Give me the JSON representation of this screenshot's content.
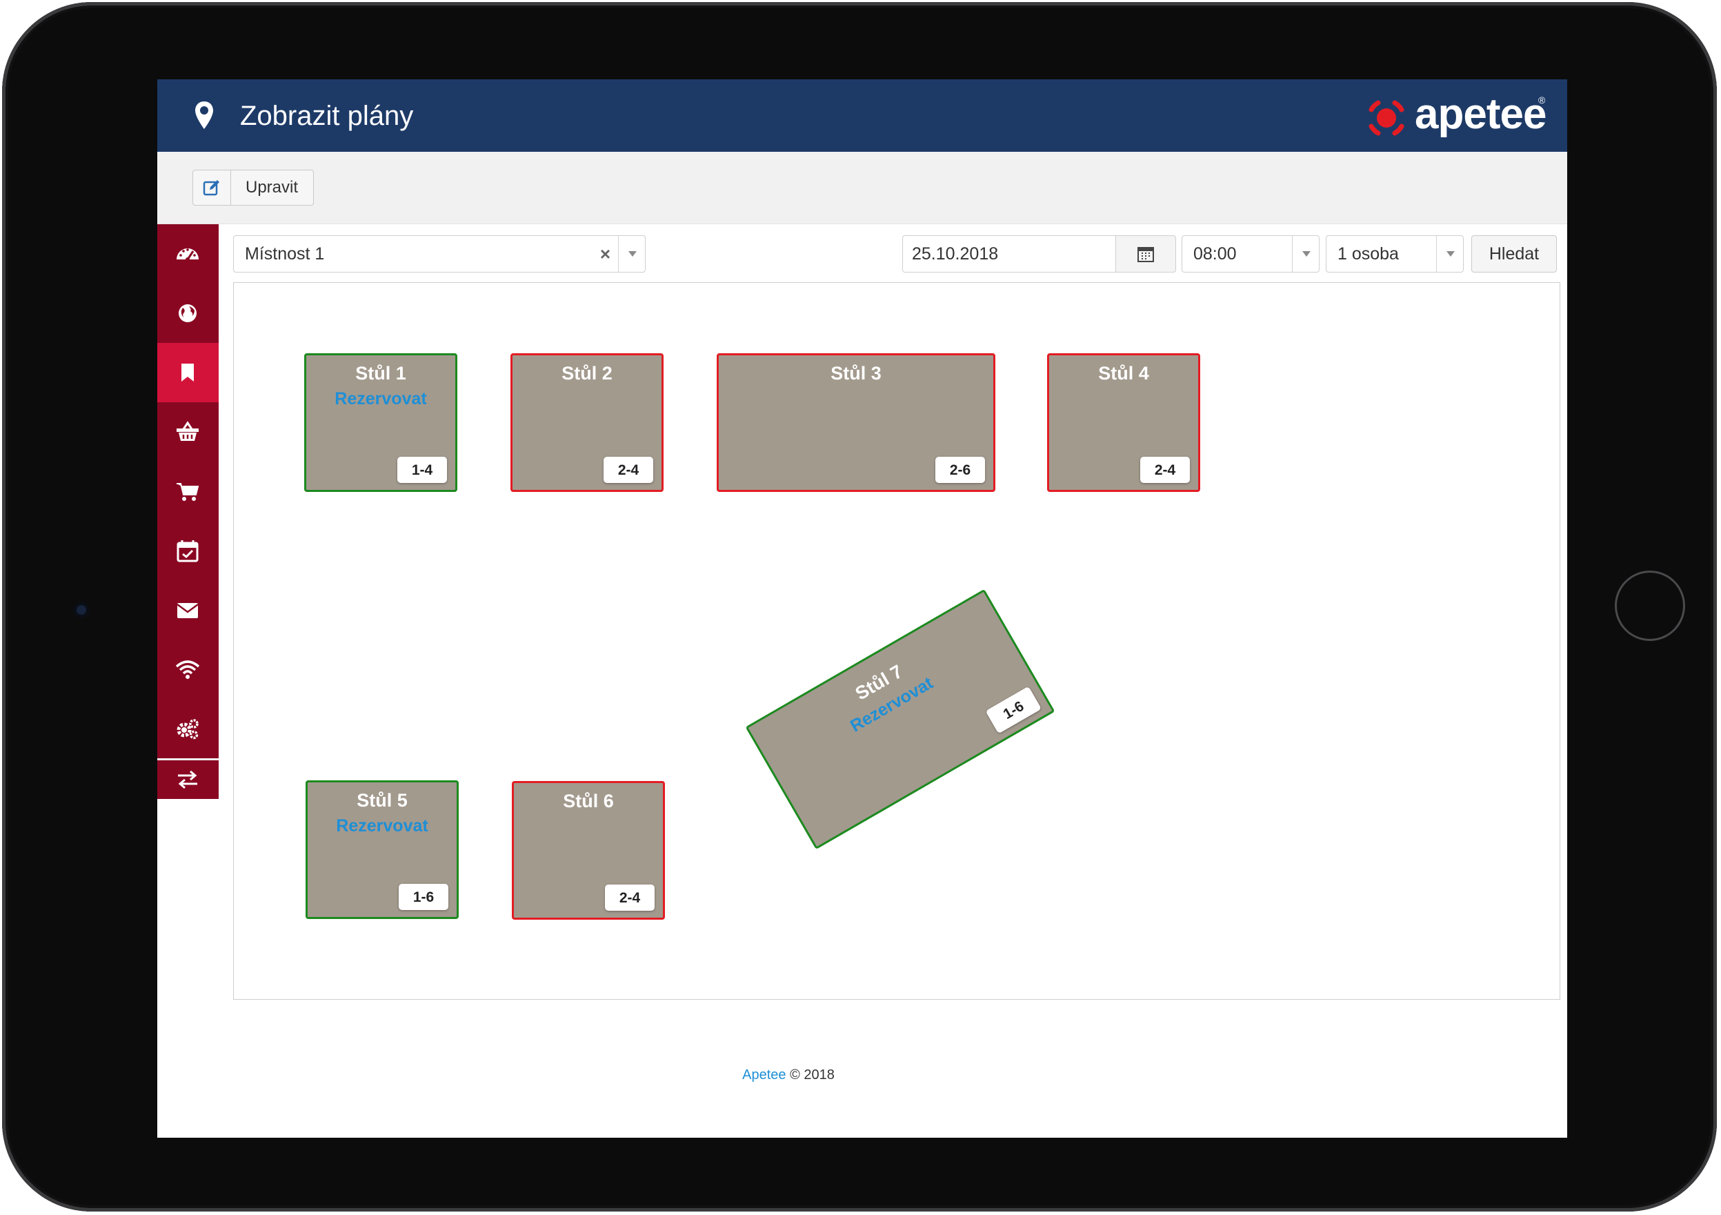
{
  "header": {
    "title": "Zobrazit plány",
    "logo_text": "apetee",
    "logo_reg": "®"
  },
  "toolbar": {
    "edit_label": "Upravit"
  },
  "sidebar": {
    "items": [
      {
        "icon": "dashboard-icon"
      },
      {
        "icon": "globe-icon"
      },
      {
        "icon": "bookmark-icon",
        "active": true
      },
      {
        "icon": "basket-icon"
      },
      {
        "icon": "cart-icon"
      },
      {
        "icon": "calendar-check-icon"
      },
      {
        "icon": "envelope-icon"
      },
      {
        "icon": "wifi-icon"
      },
      {
        "icon": "gears-icon"
      },
      {
        "icon": "exchange-icon"
      }
    ]
  },
  "filters": {
    "room": "Místnost 1",
    "date": "25.10.2018",
    "time": "08:00",
    "persons": "1 osoba",
    "search_label": "Hledat"
  },
  "tables": [
    {
      "name": "Stůl 1",
      "capacity": "1-4",
      "available": true,
      "reserve_label": "Rezervovat"
    },
    {
      "name": "Stůl 2",
      "capacity": "2-4",
      "available": false
    },
    {
      "name": "Stůl 3",
      "capacity": "2-6",
      "available": false
    },
    {
      "name": "Stůl 4",
      "capacity": "2-4",
      "available": false
    },
    {
      "name": "Stůl 5",
      "capacity": "1-6",
      "available": true,
      "reserve_label": "Rezervovat"
    },
    {
      "name": "Stůl 6",
      "capacity": "2-4",
      "available": false
    },
    {
      "name": "Stůl 7",
      "capacity": "1-6",
      "available": true,
      "reserve_label": "Rezervovat"
    }
  ],
  "footer": {
    "brand": "Apetee",
    "copyright": " © 2018"
  },
  "colors": {
    "header_bg": "#1d3a67",
    "sidebar_bg": "#8a0722",
    "sidebar_active": "#d4133b",
    "table_fill": "#a39a8e",
    "table_available_border": "#1c8a1f",
    "table_occupied_border": "#e31c23",
    "link": "#1e8fd6",
    "logo_red": "#e31c23"
  }
}
